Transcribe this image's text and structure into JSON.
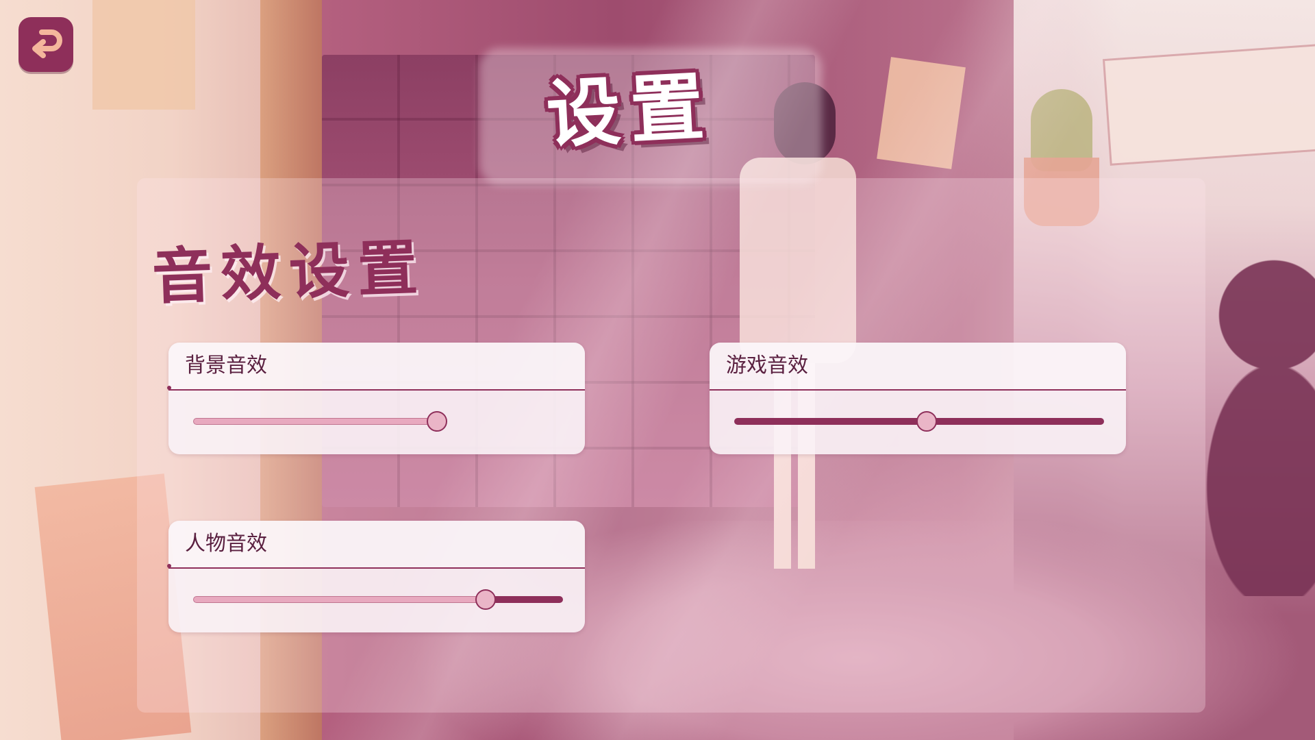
{
  "header": {
    "title": "设置",
    "back_icon": "back-arrow-icon"
  },
  "section": {
    "title": "音效设置"
  },
  "settings": [
    {
      "label": "背景音效",
      "value": 0.66,
      "style": "light"
    },
    {
      "label": "游戏音效",
      "value": 0.52,
      "style": "dark"
    },
    {
      "label": "人物音效",
      "value": 0.79,
      "style": "light-then-dark"
    }
  ],
  "colors": {
    "accent": "#8e2f5a",
    "card": "#faf2f6",
    "track_light": "#e8a9bf",
    "thumb": "#eab5c7"
  }
}
